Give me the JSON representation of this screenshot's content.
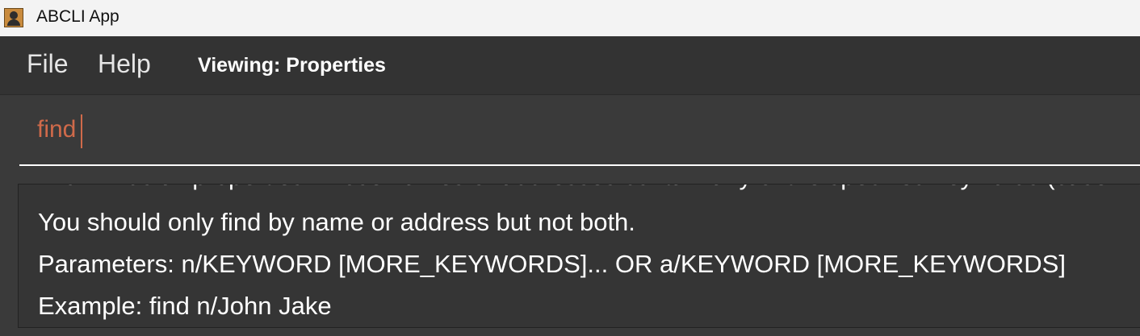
{
  "window": {
    "title": "ABCLI App",
    "icon": "address-book-icon"
  },
  "menubar": {
    "file_label": "File",
    "help_label": "Help",
    "viewing_label": "Viewing: Properties"
  },
  "command": {
    "value": "find",
    "text_color": "#d06a4a"
  },
  "result": {
    "lines": [
      "find: Finds all properties whose names or addresses contain any of the specified keywords (case-insensitive)",
      "You should only find by name or address but not both.",
      "Parameters: n/KEYWORD [MORE_KEYWORDS]... OR a/KEYWORD [MORE_KEYWORDS]",
      "Example: find n/John Jake"
    ]
  }
}
